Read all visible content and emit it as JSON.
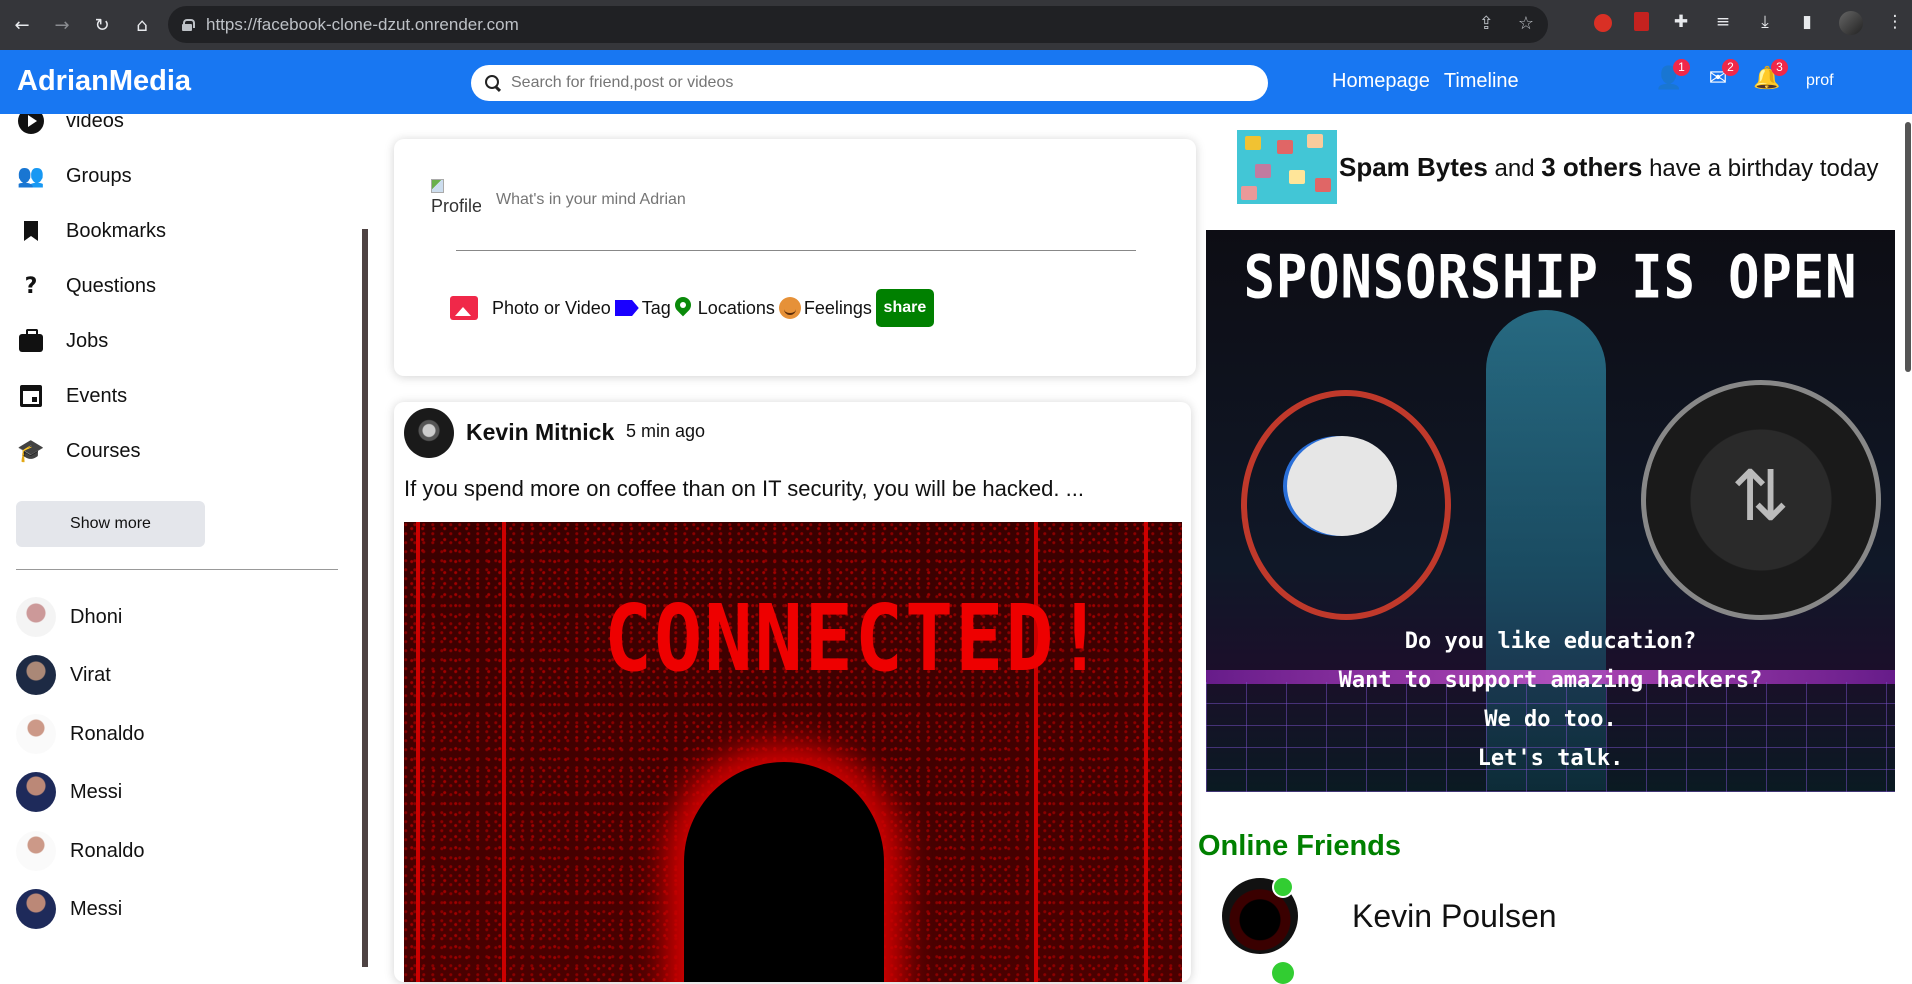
{
  "browser": {
    "url": "https://facebook-clone-dzut.onrender.com",
    "nav_icons": [
      "back-icon",
      "forward-icon",
      "reload-icon",
      "home-icon"
    ]
  },
  "topbar": {
    "logo": "AdrianMedia",
    "search_placeholder": "Search for friend,post or videos",
    "links": [
      "Homepage",
      "Timeline"
    ],
    "badges": {
      "friends": "1",
      "messages": "2",
      "notifications": "3"
    },
    "profile_alt": "prof",
    "bg_color": "#1877f2"
  },
  "sidebar": {
    "items": [
      {
        "label": "videos",
        "icon": "play-circle-icon"
      },
      {
        "label": "Groups",
        "icon": "groups-icon"
      },
      {
        "label": "Bookmarks",
        "icon": "bookmark-icon"
      },
      {
        "label": "Questions",
        "icon": "question-icon"
      },
      {
        "label": "Jobs",
        "icon": "briefcase-icon"
      },
      {
        "label": "Events",
        "icon": "calendar-icon"
      },
      {
        "label": "Courses",
        "icon": "school-icon"
      }
    ],
    "show_more": "Show more",
    "friends": [
      "Dhoni",
      "Virat",
      "Ronaldo",
      "Messi",
      "Ronaldo",
      "Messi"
    ]
  },
  "share": {
    "profile_alt": "Profile",
    "placeholder": "What's in your mind Adrian",
    "options": [
      "Photo or Video",
      "Tag",
      "Locations",
      "Feelings"
    ],
    "share_button": "share"
  },
  "post": {
    "user": "Kevin Mitnick",
    "time": "5 min ago",
    "text": "If you spend more on coffee than on IT security, you will be hacked. ...",
    "image_caption": "CONNECTED!"
  },
  "rightbar": {
    "birthday": {
      "name": "Spam Bytes",
      "and": "and",
      "others": "3 others",
      "suffix": "have a birthday today"
    },
    "ad": {
      "title": "SPONSORSHIP IS OPEN",
      "lines": [
        "Do you like education?",
        "Want to support amazing hackers?",
        "We do too.",
        "Let's talk."
      ]
    },
    "online_title": "Online Friends",
    "online_friends": [
      "Kevin Poulsen"
    ],
    "online_color": "#008000"
  }
}
